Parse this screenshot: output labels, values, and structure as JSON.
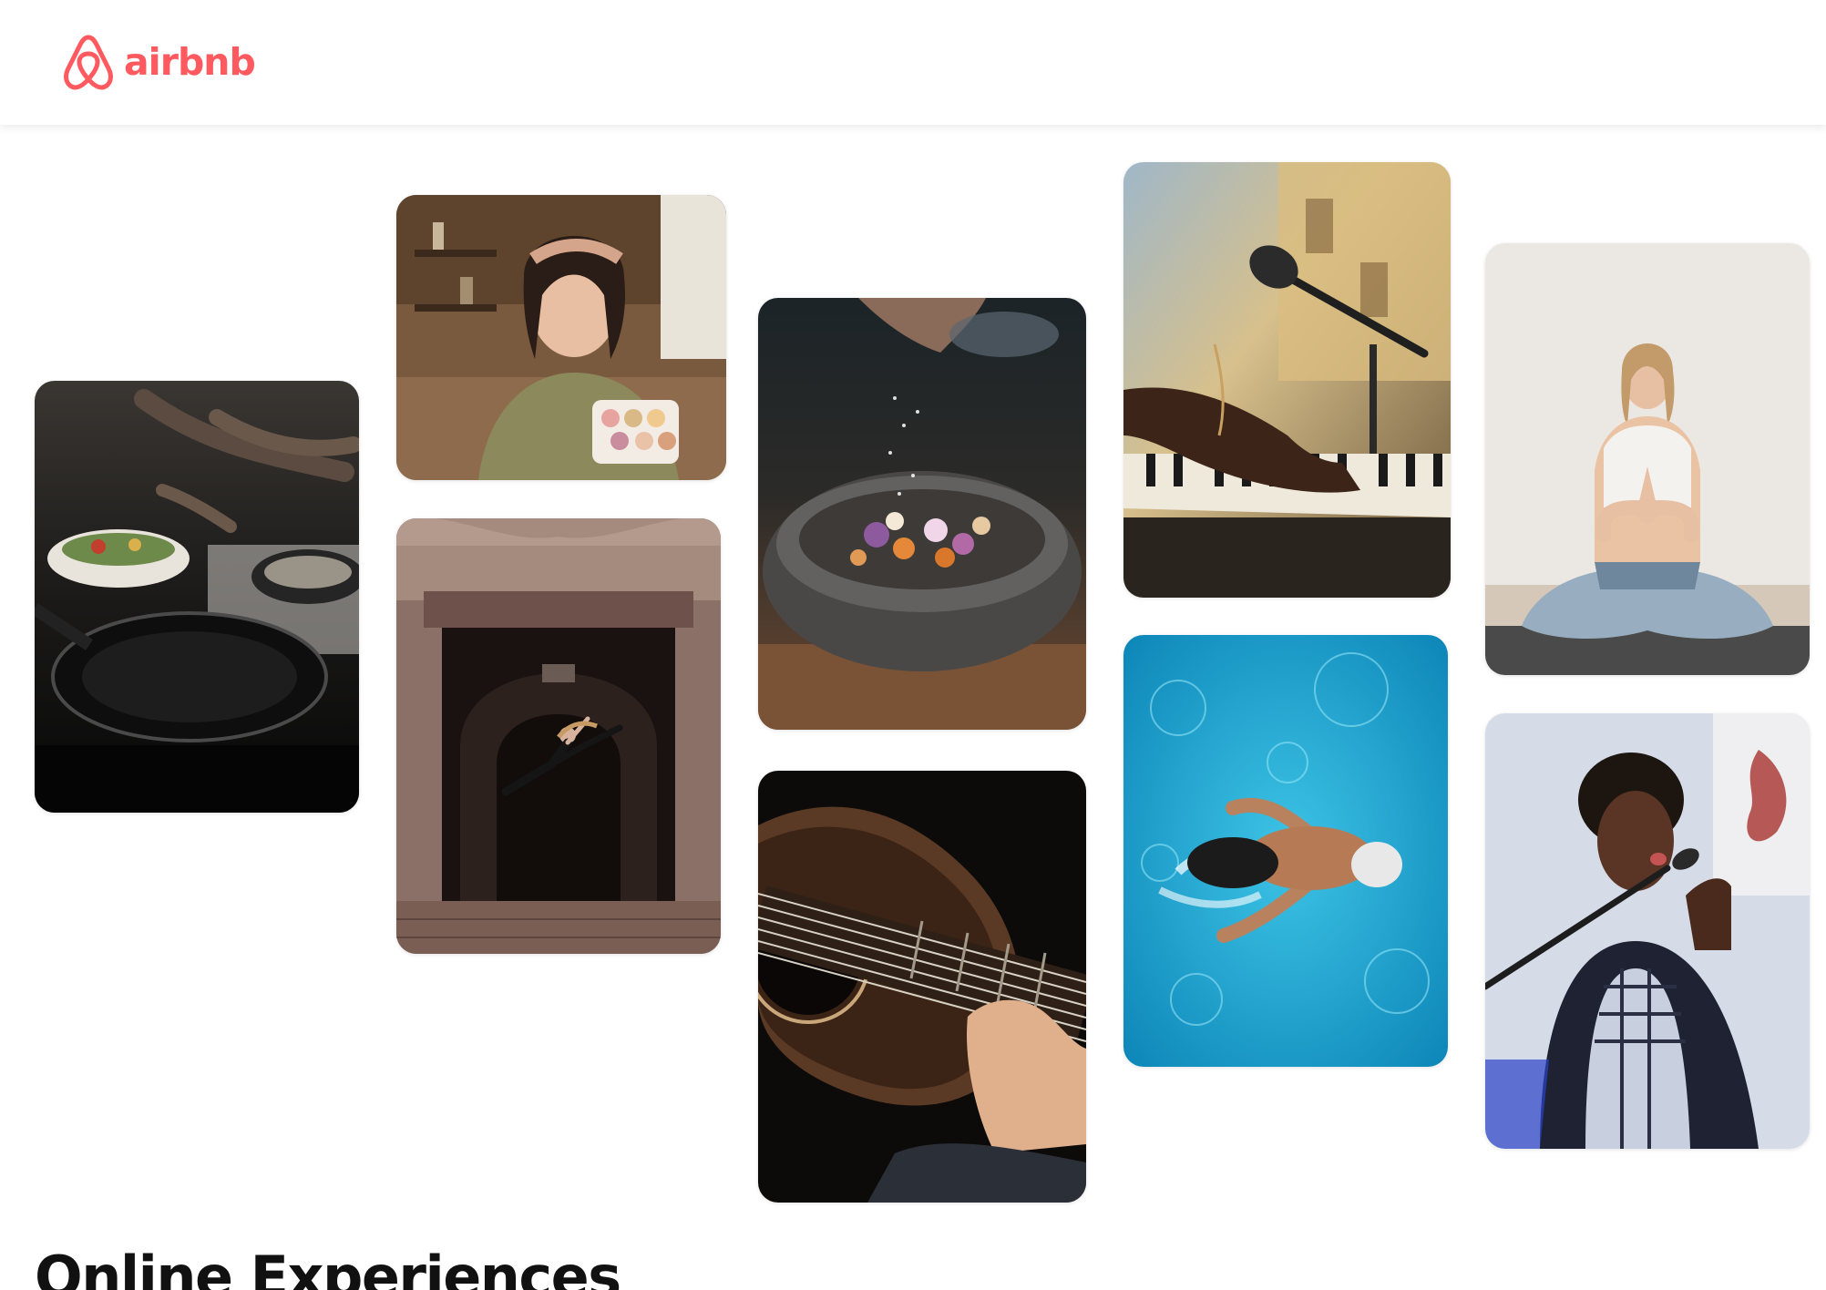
{
  "header": {
    "brand": "airbnb",
    "brand_color": "#FF5A5F",
    "logo_icon": "airbnb-belo-icon"
  },
  "gallery": {
    "photos": [
      {
        "subject": "cooking-pan"
      },
      {
        "subject": "macarons-woman"
      },
      {
        "subject": "dancer-archway"
      },
      {
        "subject": "spice-bowl"
      },
      {
        "subject": "acoustic-guitar"
      },
      {
        "subject": "piano-microphone"
      },
      {
        "subject": "swimmer-pool"
      },
      {
        "subject": "yoga-meditation"
      },
      {
        "subject": "singer-microphone"
      }
    ]
  },
  "section": {
    "title": "Online Experiences"
  }
}
